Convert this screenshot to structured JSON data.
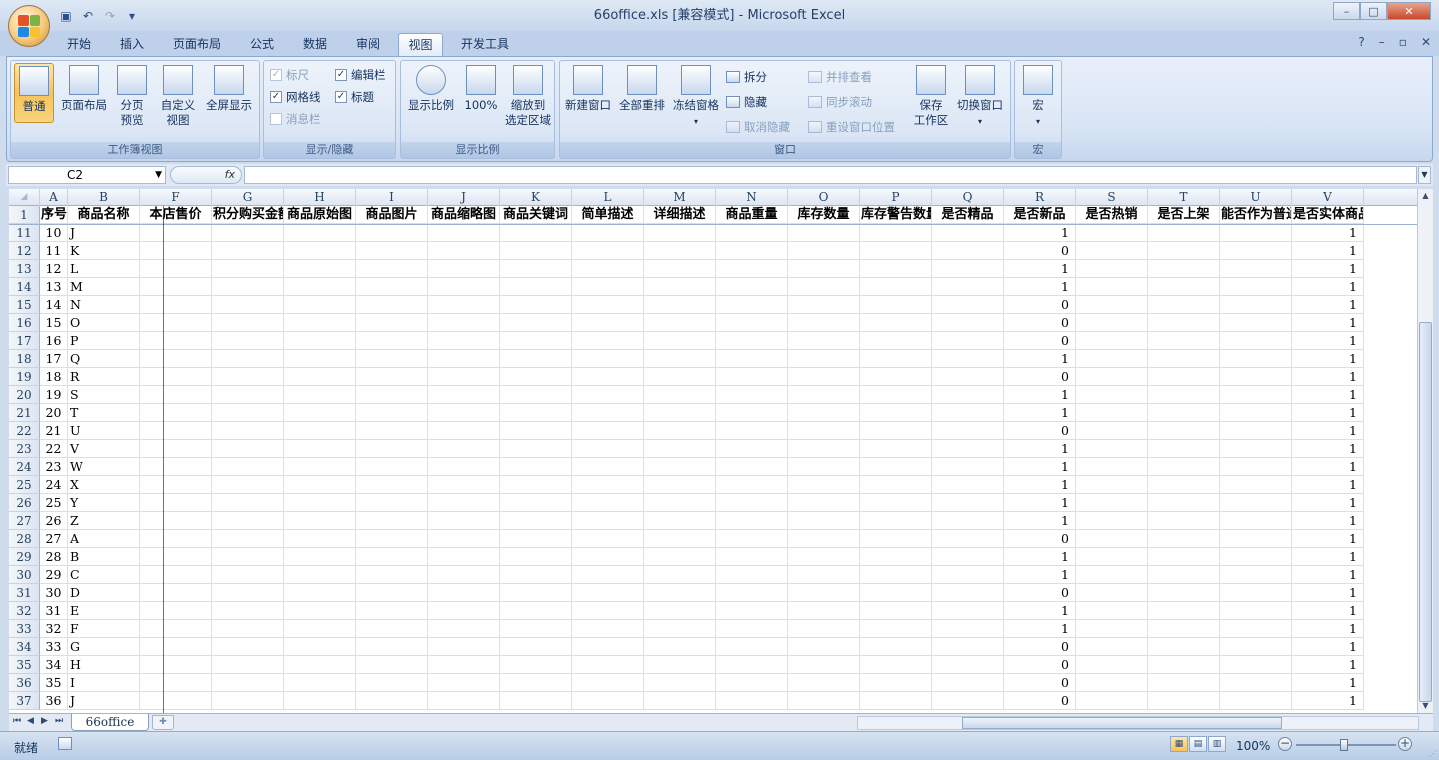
{
  "window": {
    "title": "66office.xls  [兼容模式] - Microsoft Excel",
    "controls": {
      "minimize": "–",
      "maximize": "□",
      "close": "✕"
    }
  },
  "quick_access": {
    "save_icon": "save-icon",
    "undo_icon": "undo-icon",
    "redo_icon": "redo-icon",
    "customize": "▾"
  },
  "ribbon_tabs": [
    "开始",
    "插入",
    "页面布局",
    "公式",
    "数据",
    "审阅",
    "视图",
    "开发工具"
  ],
  "active_tab": "视图",
  "ribbon": {
    "workbook_views": {
      "label": "工作簿视图",
      "normal": "普通",
      "page_layout": "页面布局",
      "page_break_1": "分页",
      "page_break_2": "预览",
      "custom_1": "自定义",
      "custom_2": "视图",
      "fullscreen": "全屏显示"
    },
    "show_hide": {
      "label": "显示/隐藏",
      "ruler": "标尺",
      "formula_bar": "编辑栏",
      "gridlines": "网格线",
      "headings": "标题",
      "message_bar": "消息栏"
    },
    "zoom": {
      "label": "显示比例",
      "zoom": "显示比例",
      "hundred": "100%",
      "zoom_sel_1": "缩放到",
      "zoom_sel_2": "选定区域"
    },
    "window": {
      "label": "窗口",
      "new_window": "新建窗口",
      "arrange_all": "全部重排",
      "freeze_panes": "冻结窗格",
      "split": "拆分",
      "hide": "隐藏",
      "unhide": "取消隐藏",
      "view_side": "并排查看",
      "sync_scroll": "同步滚动",
      "reset_pos": "重设窗口位置",
      "save_ws_1": "保存",
      "save_ws_2": "工作区",
      "switch_win": "切换窗口"
    },
    "macros": {
      "label": "宏",
      "macros": "宏"
    }
  },
  "formula_bar": {
    "name_box": "C2",
    "fx": "fx",
    "formula": ""
  },
  "sheet": {
    "columns": [
      "A",
      "B",
      "F",
      "G",
      "H",
      "I",
      "J",
      "K",
      "L",
      "M",
      "N",
      "O",
      "P",
      "Q",
      "R",
      "S",
      "T",
      "U",
      "V"
    ],
    "header_row": {
      "row_number": "1",
      "cells": [
        "序号",
        "商品名称",
        "本店售价",
        "积分购买金额",
        "商品原始图",
        "商品图片",
        "商品缩略图",
        "商品关键词",
        "简单描述",
        "详细描述",
        "商品重量",
        "库存数量",
        "库存警告数量",
        "是否精品",
        "是否新品",
        "是否热销",
        "是否上架",
        "能否作为普通商品销售",
        "是否实体商品"
      ]
    },
    "rows": [
      {
        "rn": "11",
        "a": "10",
        "b": "J",
        "r": "1",
        "v": "1"
      },
      {
        "rn": "12",
        "a": "11",
        "b": "K",
        "r": "0",
        "v": "1"
      },
      {
        "rn": "13",
        "a": "12",
        "b": "L",
        "r": "1",
        "v": "1"
      },
      {
        "rn": "14",
        "a": "13",
        "b": "M",
        "r": "1",
        "v": "1"
      },
      {
        "rn": "15",
        "a": "14",
        "b": "N",
        "r": "0",
        "v": "1"
      },
      {
        "rn": "16",
        "a": "15",
        "b": "O",
        "r": "0",
        "v": "1"
      },
      {
        "rn": "17",
        "a": "16",
        "b": "P",
        "r": "0",
        "v": "1"
      },
      {
        "rn": "18",
        "a": "17",
        "b": "Q",
        "r": "1",
        "v": "1"
      },
      {
        "rn": "19",
        "a": "18",
        "b": "R",
        "r": "0",
        "v": "1"
      },
      {
        "rn": "20",
        "a": "19",
        "b": "S",
        "r": "1",
        "v": "1"
      },
      {
        "rn": "21",
        "a": "20",
        "b": "T",
        "r": "1",
        "v": "1"
      },
      {
        "rn": "22",
        "a": "21",
        "b": "U",
        "r": "0",
        "v": "1"
      },
      {
        "rn": "23",
        "a": "22",
        "b": "V",
        "r": "1",
        "v": "1"
      },
      {
        "rn": "24",
        "a": "23",
        "b": "W",
        "r": "1",
        "v": "1"
      },
      {
        "rn": "25",
        "a": "24",
        "b": "X",
        "r": "1",
        "v": "1"
      },
      {
        "rn": "26",
        "a": "25",
        "b": "Y",
        "r": "1",
        "v": "1"
      },
      {
        "rn": "27",
        "a": "26",
        "b": "Z",
        "r": "1",
        "v": "1"
      },
      {
        "rn": "28",
        "a": "27",
        "b": "A",
        "r": "0",
        "v": "1"
      },
      {
        "rn": "29",
        "a": "28",
        "b": "B",
        "r": "1",
        "v": "1"
      },
      {
        "rn": "30",
        "a": "29",
        "b": "C",
        "r": "1",
        "v": "1"
      },
      {
        "rn": "31",
        "a": "30",
        "b": "D",
        "r": "0",
        "v": "1"
      },
      {
        "rn": "32",
        "a": "31",
        "b": "E",
        "r": "1",
        "v": "1"
      },
      {
        "rn": "33",
        "a": "32",
        "b": "F",
        "r": "1",
        "v": "1"
      },
      {
        "rn": "34",
        "a": "33",
        "b": "G",
        "r": "0",
        "v": "1"
      },
      {
        "rn": "35",
        "a": "34",
        "b": "H",
        "r": "0",
        "v": "1"
      },
      {
        "rn": "36",
        "a": "35",
        "b": "I",
        "r": "0",
        "v": "1"
      },
      {
        "rn": "37",
        "a": "36",
        "b": "J",
        "r": "0",
        "v": "1"
      }
    ]
  },
  "sheet_tabs": [
    "66office"
  ],
  "status": {
    "ready": "就绪",
    "zoom": "100%"
  },
  "colors": {
    "accent": "#f7c35a",
    "ribbon_bg": "#dbe6f5",
    "title_bg": "#c6d6ec"
  }
}
